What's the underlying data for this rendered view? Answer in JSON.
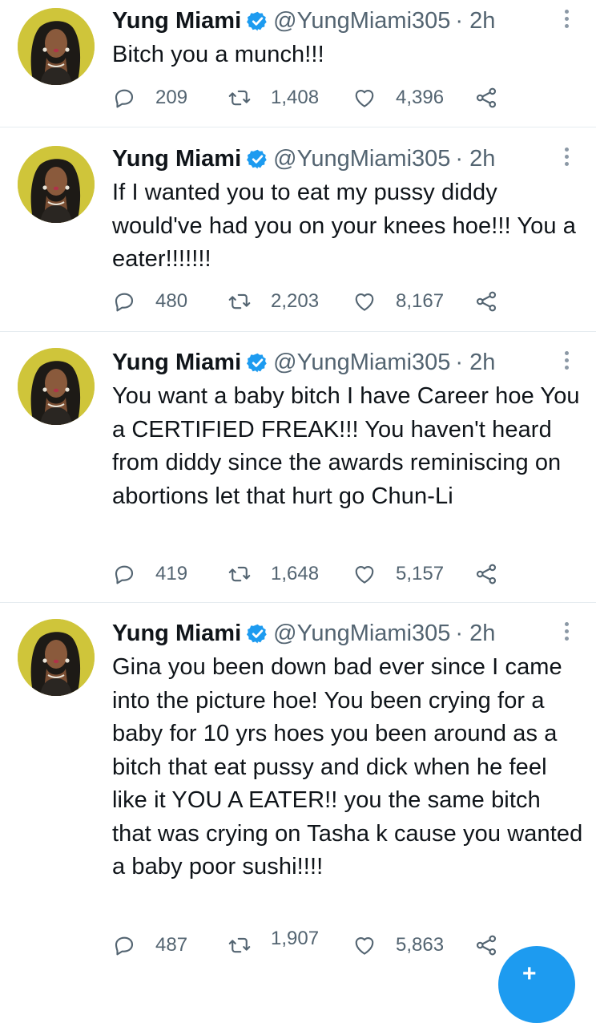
{
  "tweets": [
    {
      "author": "Yung Miami",
      "handle": "@YungMiami305",
      "time": "· 2h",
      "text": "Bitch you a munch!!!",
      "replies": "209",
      "retweets": "1,408",
      "likes": "4,396"
    },
    {
      "author": "Yung Miami",
      "handle": "@YungMiami305",
      "time": "· 2h",
      "text": "If I wanted you to eat my pussy diddy would've had you on your knees hoe!!! You a eater!!!!!!!",
      "replies": "480",
      "retweets": "2,203",
      "likes": "8,167"
    },
    {
      "author": "Yung Miami",
      "handle": "@YungMiami305",
      "time": "· 2h",
      "text": "You want a baby bitch I have Career hoe You a CERTIFIED FREAK!!! You haven't heard from diddy since the awards reminiscing on abortions let that hurt go Chun-Li",
      "replies": "419",
      "retweets": "1,648",
      "likes": "5,157"
    },
    {
      "author": "Yung Miami",
      "handle": "@YungMiami305",
      "time": "· 2h",
      "text": "Gina you been down bad ever since I came into the picture hoe! You been crying for a baby for 10 yrs hoes you been around as a bitch that eat pussy and dick when he feel like it YOU A EATER!! you the same bitch that was crying on Tasha k cause you wanted a baby poor sushi!!!!",
      "replies": "487",
      "retweets": "1,907",
      "likes": "5,863"
    }
  ],
  "icons": {
    "verified": "verified-badge-icon",
    "more": "more-vertical-icon",
    "reply": "reply-icon",
    "retweet": "retweet-icon",
    "like": "heart-icon",
    "share": "share-icon",
    "compose": "compose-icon"
  },
  "colors": {
    "accent": "#1d9bf0",
    "secondary_text": "#536471",
    "avatar_background": "#cfc53a"
  }
}
